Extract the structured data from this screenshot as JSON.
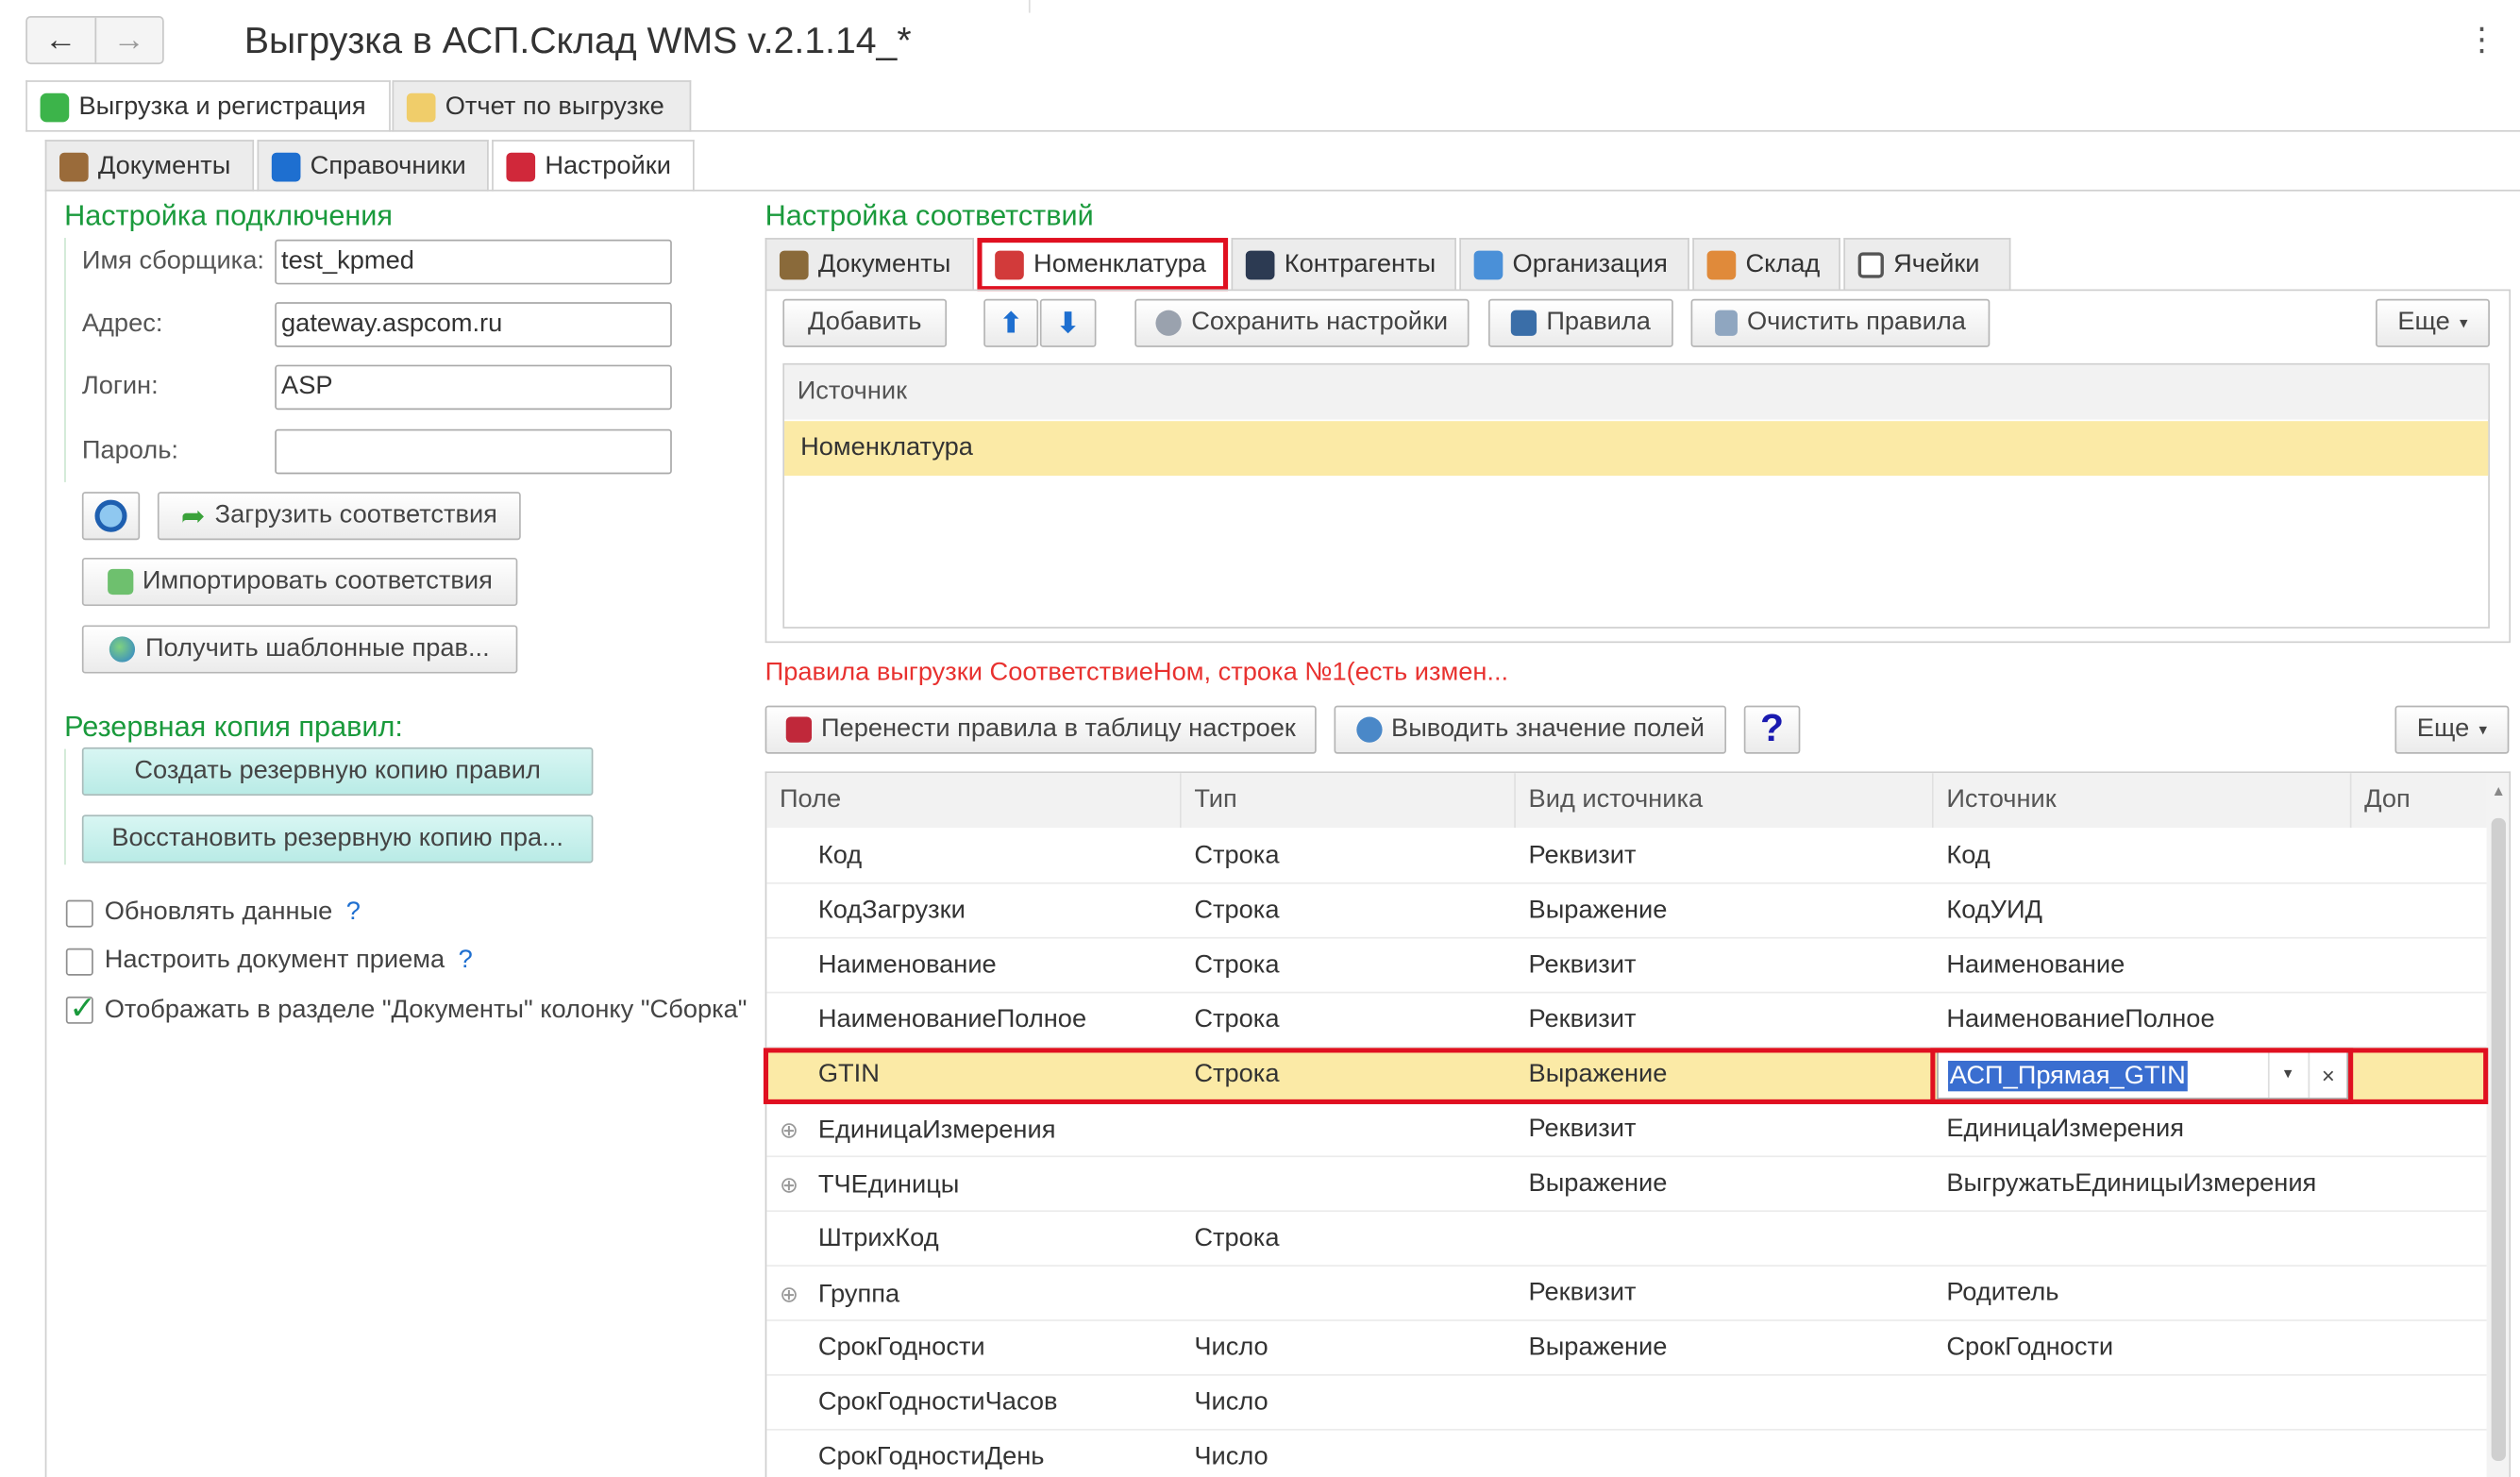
{
  "window": {
    "title": "Выгрузка в АСП.Склад WMS v.2.1.14_*",
    "more_glyph": "⋮",
    "back_glyph": "←",
    "forward_glyph": "→"
  },
  "top_tabs": [
    "Выгрузка и регистрация",
    "Отчет по выгрузке"
  ],
  "sub_tabs": [
    "Документы",
    "Справочники",
    "Настройки"
  ],
  "connection": {
    "title": "Настройка подключения",
    "picker_label": "Имя сборщика:",
    "picker_value": "test_kpmed",
    "address_label": "Адрес:",
    "address_value": "gateway.aspcom.ru",
    "login_label": "Логин:",
    "login_value": "ASP",
    "password_label": "Пароль:",
    "password_value": "",
    "load_button": "Загрузить соответствия",
    "import_button": "Импортировать соответствия",
    "templates_button": "Получить шаблонные прав..."
  },
  "backup": {
    "title": "Резервная копия правил:",
    "create_button": "Создать резервную копию правил",
    "restore_button": "Восстановить резервную копию пра..."
  },
  "options": {
    "update_data": "Обновлять данные",
    "setup_doc": "Настроить документ приема",
    "show_column": "Отображать в разделе \"Документы\" колонку \"Сборка\"",
    "help_glyph": "?"
  },
  "mapping": {
    "title": "Настройка соответствий",
    "tabs": [
      "Документы",
      "Номенклатура",
      "Контрагенты",
      "Организация",
      "Склад",
      "Ячейки"
    ],
    "toolbar": {
      "add": "Добавить",
      "save": "Сохранить настройки",
      "rules": "Правила",
      "clear": "Очистить правила",
      "more": "Еще"
    },
    "source_header": "Источник",
    "source_rows": [
      "Номенклатура"
    ]
  },
  "rules": {
    "status": "Правила выгрузки СоответствиеНом, строка №1(есть измен...",
    "transfer_button": "Перенести правила в таблицу настроек",
    "show_values_button": "Выводить значение полей",
    "help_button": "?",
    "more": "Еще",
    "columns": [
      "Поле",
      "Тип",
      "Вид источника",
      "Источник",
      "Доп"
    ],
    "rows": [
      {
        "field": "Код",
        "type": "Строка",
        "kind": "Реквизит",
        "source": "Код",
        "expand": ""
      },
      {
        "field": "КодЗагрузки",
        "type": "Строка",
        "kind": "Выражение",
        "source": "КодУИД",
        "expand": ""
      },
      {
        "field": "Наименование",
        "type": "Строка",
        "kind": "Реквизит",
        "source": "Наименование",
        "expand": ""
      },
      {
        "field": "НаименованиеПолное",
        "type": "Строка",
        "kind": "Реквизит",
        "source": "НаименованиеПолное",
        "expand": ""
      },
      {
        "field": "GTIN",
        "type": "Строка",
        "kind": "Выражение",
        "source": "АСП_Прямая_GTIN",
        "expand": ""
      },
      {
        "field": "ЕдиницаИзмерения",
        "type": "",
        "kind": "Реквизит",
        "source": "ЕдиницаИзмерения",
        "expand": "⊕"
      },
      {
        "field": "ТЧЕдиницы",
        "type": "",
        "kind": "Выражение",
        "source": "ВыгружатьЕдиницыИзмерения",
        "expand": "⊕"
      },
      {
        "field": "ШтрихКод",
        "type": "Строка",
        "kind": "",
        "source": "",
        "expand": ""
      },
      {
        "field": "Группа",
        "type": "",
        "kind": "Реквизит",
        "source": "Родитель",
        "expand": "⊕"
      },
      {
        "field": "СрокГодности",
        "type": "Число",
        "kind": "Выражение",
        "source": "СрокГодности",
        "expand": ""
      },
      {
        "field": "СрокГодностиЧасов",
        "type": "Число",
        "kind": "",
        "source": "",
        "expand": ""
      },
      {
        "field": "СрокГодностиДень",
        "type": "Число",
        "kind": "",
        "source": "",
        "expand": ""
      }
    ],
    "editor_dropdown_glyph": "▾",
    "editor_clear_glyph": "×"
  },
  "colors": {
    "accent_green": "#1a9a3c",
    "highlight_row": "#fbeaa6",
    "callout_red": "#e01020",
    "status_red": "#e8312f"
  }
}
